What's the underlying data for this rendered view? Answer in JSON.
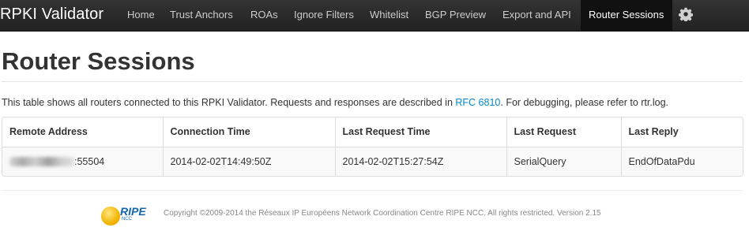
{
  "navbar": {
    "brand": "RPKI Validator",
    "items": [
      {
        "label": "Home"
      },
      {
        "label": "Trust Anchors"
      },
      {
        "label": "ROAs"
      },
      {
        "label": "Ignore Filters"
      },
      {
        "label": "Whitelist"
      },
      {
        "label": "BGP Preview"
      },
      {
        "label": "Export and API"
      },
      {
        "label": "Router Sessions",
        "active": true
      }
    ],
    "settings_icon": "gear-icon"
  },
  "page": {
    "title": "Router Sessions",
    "description_before": "This table shows all routers connected to this RPKI Validator. Requests and responses are described in ",
    "description_link": "RFC 6810",
    "description_after": ". For debugging, please refer to rtr.log."
  },
  "table": {
    "headers": [
      "Remote Address",
      "Connection Time",
      "Last Request Time",
      "Last Request",
      "Last Reply"
    ],
    "rows": [
      {
        "remote_address_suffix": ":55504",
        "connection_time": "2014-02-02T14:49:50Z",
        "last_request_time": "2014-02-02T15:27:54Z",
        "last_request": "SerialQuery",
        "last_reply": "EndOfDataPdu"
      }
    ]
  },
  "footer": {
    "logo_text": "RIPE",
    "logo_subtext": "NCC",
    "copyright": "Copyright ©2009-2014 the Réseaux IP Européens Network Coordination Centre RIPE NCC. All rights restricted. Version 2.15"
  },
  "colors": {
    "navbar_bg": "#222222",
    "link": "#0088cc",
    "ripe_blue": "#1565a8",
    "ripe_orange": "#f2b500"
  }
}
